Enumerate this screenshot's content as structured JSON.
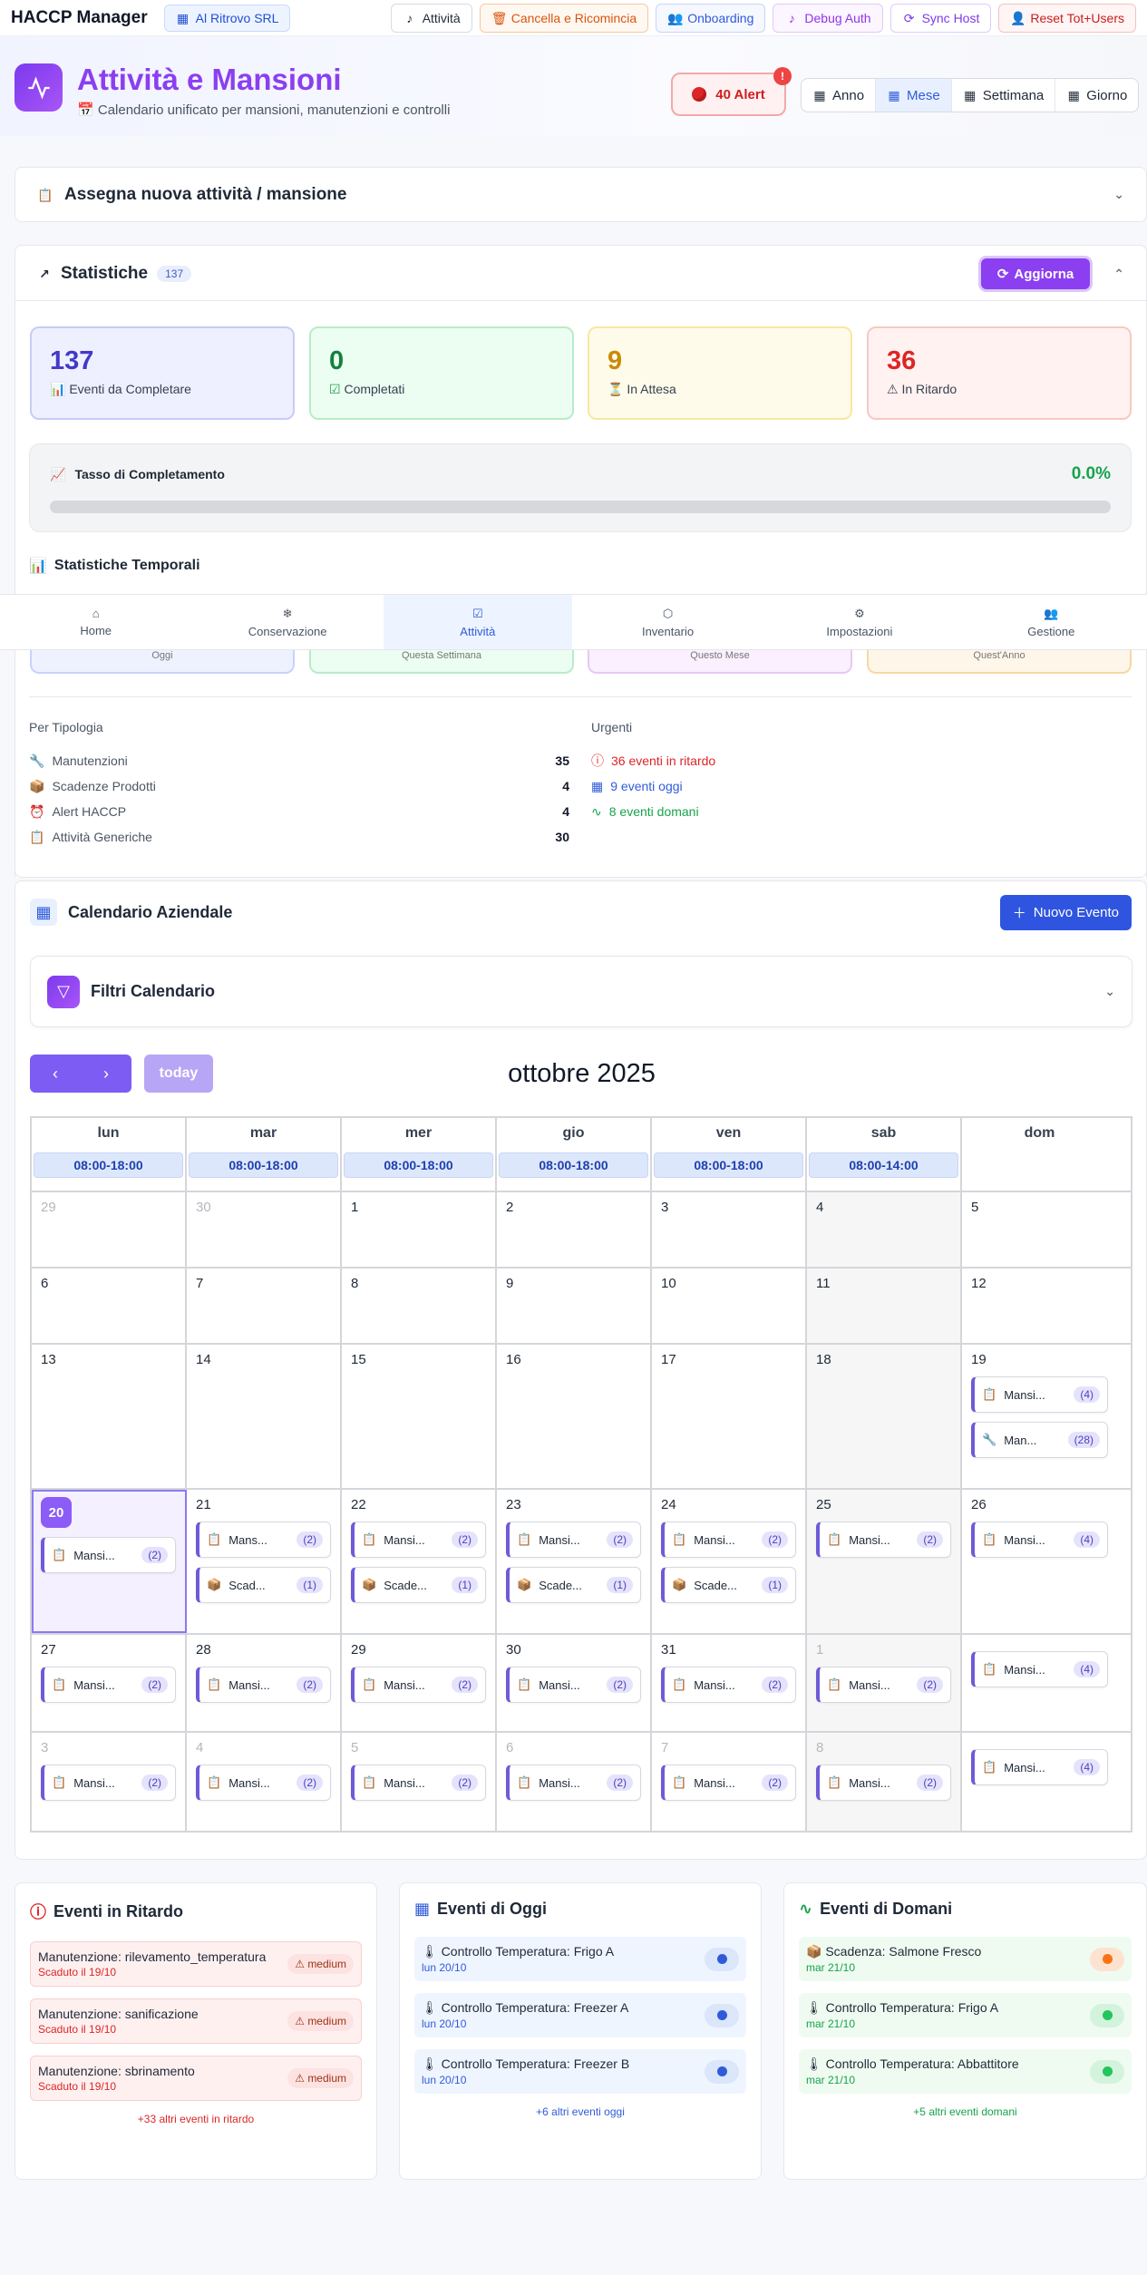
{
  "topbar": {
    "app_name": "HACCP Manager",
    "company": "Al Ritrovo SRL",
    "buttons": [
      "Attività",
      "Cancella e Ricomincia",
      "Onboarding",
      "Debug Auth",
      "Sync Host",
      "Reset Tot+Users"
    ]
  },
  "header": {
    "title": "Attività e Mansioni",
    "subtitle": "Calendario unificato per mansioni, manutenzioni e controlli",
    "alert_label": "40 Alert",
    "alert_badge": "!",
    "views": [
      "Anno",
      "Mese",
      "Settimana",
      "Giorno"
    ],
    "active_view": "Mese"
  },
  "assign": {
    "title": "Assegna nuova attività / mansione"
  },
  "stats": {
    "title": "Statistiche",
    "count": "137",
    "refresh": "Aggiorna",
    "kpis": [
      {
        "value": "137",
        "label": "Eventi da Completare",
        "color": "#4338ca"
      },
      {
        "value": "0",
        "label": "Completati",
        "color": "#15803d"
      },
      {
        "value": "9",
        "label": "In Attesa",
        "color": "#ca8a04"
      },
      {
        "value": "36",
        "label": "In Ritardo",
        "color": "#dc2626"
      }
    ],
    "rate_label": "Tasso di Completamento",
    "rate_value": "0.0%",
    "rate_fraction": 0.0,
    "temporal_title": "Statistiche Temporali",
    "periods": [
      "Oggi",
      "Questa Settimana",
      "Questo Mese",
      "Quest'Anno"
    ],
    "by_type_title": "Per Tipologia",
    "by_type": [
      {
        "label": "Manutenzioni",
        "value": "35"
      },
      {
        "label": "Scadenze Prodotti",
        "value": "4"
      },
      {
        "label": "Alert HACCP",
        "value": "4"
      },
      {
        "label": "Attività Generiche",
        "value": "30"
      }
    ],
    "urgent_title": "Urgenti",
    "urgent": [
      {
        "label": "36 eventi in ritardo",
        "color": "#dc2626"
      },
      {
        "label": "9 eventi oggi",
        "color": "#2f5bd9"
      },
      {
        "label": "8 eventi domani",
        "color": "#16a34a"
      }
    ]
  },
  "nav": {
    "items": [
      "Home",
      "Conservazione",
      "Attività",
      "Inventario",
      "Impostazioni",
      "Gestione"
    ],
    "active": "Attività"
  },
  "calendar": {
    "title": "Calendario Aziendale",
    "new_event": "Nuovo Evento",
    "filters_title": "Filtri Calendario",
    "today_label": "today",
    "month_label": "ottobre 2025",
    "weekdays": [
      "lun",
      "mar",
      "mer",
      "gio",
      "ven",
      "sab",
      "dom"
    ],
    "hours": [
      "08:00-18:00",
      "08:00-18:00",
      "08:00-18:00",
      "08:00-18:00",
      "08:00-18:00",
      "08:00-14:00",
      ""
    ],
    "weeks": [
      {
        "days": [
          {
            "n": "29",
            "muted": true,
            "events": []
          },
          {
            "n": "30",
            "muted": true,
            "events": []
          },
          {
            "n": "1",
            "events": []
          },
          {
            "n": "2",
            "events": []
          },
          {
            "n": "3",
            "events": []
          },
          {
            "n": "4",
            "events": []
          },
          {
            "n": "5",
            "events": []
          }
        ]
      },
      {
        "days": [
          {
            "n": "6",
            "events": []
          },
          {
            "n": "7",
            "events": []
          },
          {
            "n": "8",
            "events": []
          },
          {
            "n": "9",
            "events": []
          },
          {
            "n": "10",
            "events": []
          },
          {
            "n": "11",
            "events": []
          },
          {
            "n": "12",
            "events": []
          }
        ]
      },
      {
        "days": [
          {
            "n": "13",
            "events": []
          },
          {
            "n": "14",
            "events": []
          },
          {
            "n": "15",
            "events": []
          },
          {
            "n": "16",
            "events": []
          },
          {
            "n": "17",
            "events": []
          },
          {
            "n": "18",
            "events": []
          },
          {
            "n": "19",
            "events": [
              {
                "icon": "clipboard",
                "label": "Mansi...",
                "count": "(4)"
              },
              {
                "icon": "wrench",
                "label": "Man...",
                "count": "(28)"
              }
            ]
          }
        ]
      },
      {
        "days": [
          {
            "n": "20",
            "today": true,
            "events": [
              {
                "icon": "clipboard",
                "label": "Mansi...",
                "count": "(2)"
              }
            ]
          },
          {
            "n": "21",
            "events": [
              {
                "icon": "clipboard",
                "label": "Mans...",
                "count": "(2)"
              },
              {
                "icon": "box",
                "label": "Scad...",
                "count": "(1)"
              }
            ]
          },
          {
            "n": "22",
            "events": [
              {
                "icon": "clipboard",
                "label": "Mansi...",
                "count": "(2)"
              },
              {
                "icon": "box",
                "label": "Scade...",
                "count": "(1)"
              }
            ]
          },
          {
            "n": "23",
            "events": [
              {
                "icon": "clipboard",
                "label": "Mansi...",
                "count": "(2)"
              },
              {
                "icon": "box",
                "label": "Scade...",
                "count": "(1)"
              }
            ]
          },
          {
            "n": "24",
            "events": [
              {
                "icon": "clipboard",
                "label": "Mansi...",
                "count": "(2)"
              },
              {
                "icon": "box",
                "label": "Scade...",
                "count": "(1)"
              }
            ]
          },
          {
            "n": "25",
            "events": [
              {
                "icon": "clipboard",
                "label": "Mansi...",
                "count": "(2)"
              }
            ]
          },
          {
            "n": "26",
            "events": [
              {
                "icon": "clipboard",
                "label": "Mansi...",
                "count": "(4)"
              }
            ]
          }
        ]
      },
      {
        "days": [
          {
            "n": "27",
            "events": [
              {
                "icon": "clipboard",
                "label": "Mansi...",
                "count": "(2)"
              }
            ]
          },
          {
            "n": "28",
            "events": [
              {
                "icon": "clipboard",
                "label": "Mansi...",
                "count": "(2)"
              }
            ]
          },
          {
            "n": "29",
            "events": [
              {
                "icon": "clipboard",
                "label": "Mansi...",
                "count": "(2)"
              }
            ]
          },
          {
            "n": "30",
            "events": [
              {
                "icon": "clipboard",
                "label": "Mansi...",
                "count": "(2)"
              }
            ]
          },
          {
            "n": "31",
            "events": [
              {
                "icon": "clipboard",
                "label": "Mansi...",
                "count": "(2)"
              }
            ]
          },
          {
            "n": "1",
            "muted": true,
            "events": [
              {
                "icon": "clipboard",
                "label": "Mansi...",
                "count": "(2)"
              }
            ]
          },
          {
            "n": "",
            "events": [
              {
                "icon": "clipboard",
                "label": "Mansi...",
                "count": "(4)"
              }
            ]
          }
        ]
      },
      {
        "days": [
          {
            "n": "3",
            "muted": true,
            "events": [
              {
                "icon": "clipboard",
                "label": "Mansi...",
                "count": "(2)"
              }
            ]
          },
          {
            "n": "4",
            "muted": true,
            "events": [
              {
                "icon": "clipboard",
                "label": "Mansi...",
                "count": "(2)"
              }
            ]
          },
          {
            "n": "5",
            "muted": true,
            "events": [
              {
                "icon": "clipboard",
                "label": "Mansi...",
                "count": "(2)"
              }
            ]
          },
          {
            "n": "6",
            "muted": true,
            "events": [
              {
                "icon": "clipboard",
                "label": "Mansi...",
                "count": "(2)"
              }
            ]
          },
          {
            "n": "7",
            "muted": true,
            "events": [
              {
                "icon": "clipboard",
                "label": "Mansi...",
                "count": "(2)"
              }
            ]
          },
          {
            "n": "8",
            "muted": true,
            "events": [
              {
                "icon": "clipboard",
                "label": "Mansi...",
                "count": "(2)"
              }
            ]
          },
          {
            "n": "",
            "events": [
              {
                "icon": "clipboard",
                "label": "Mansi...",
                "count": "(4)"
              }
            ]
          }
        ]
      }
    ]
  },
  "overdue": {
    "title": "Eventi in Ritardo",
    "items": [
      {
        "title": "Manutenzione: rilevamento_temperatura",
        "sub": "Scaduto il 19/10",
        "level": "medium"
      },
      {
        "title": "Manutenzione: sanificazione",
        "sub": "Scaduto il 19/10",
        "level": "medium"
      },
      {
        "title": "Manutenzione: sbrinamento",
        "sub": "Scaduto il 19/10",
        "level": "medium"
      }
    ],
    "more": "+33 altri eventi in ritardo"
  },
  "today_events": {
    "title": "Eventi di Oggi",
    "items": [
      {
        "title": "Controllo Temperatura: Frigo A",
        "sub": "lun 20/10"
      },
      {
        "title": "Controllo Temperatura: Freezer A",
        "sub": "lun 20/10"
      },
      {
        "title": "Controllo Temperatura: Freezer B",
        "sub": "lun 20/10"
      }
    ],
    "more": "+6 altri eventi oggi"
  },
  "tomorrow_events": {
    "title": "Eventi di Domani",
    "items": [
      {
        "icon": "box",
        "title": "Scadenza: Salmone Fresco",
        "sub": "mar 21/10",
        "dot": "#f97316"
      },
      {
        "icon": "thermo",
        "title": "Controllo Temperatura: Frigo A",
        "sub": "mar 21/10",
        "dot": "#22c55e"
      },
      {
        "icon": "thermo",
        "title": "Controllo Temperatura: Abbattitore",
        "sub": "mar 21/10",
        "dot": "#22c55e"
      }
    ],
    "more": "+5 altri eventi domani"
  }
}
